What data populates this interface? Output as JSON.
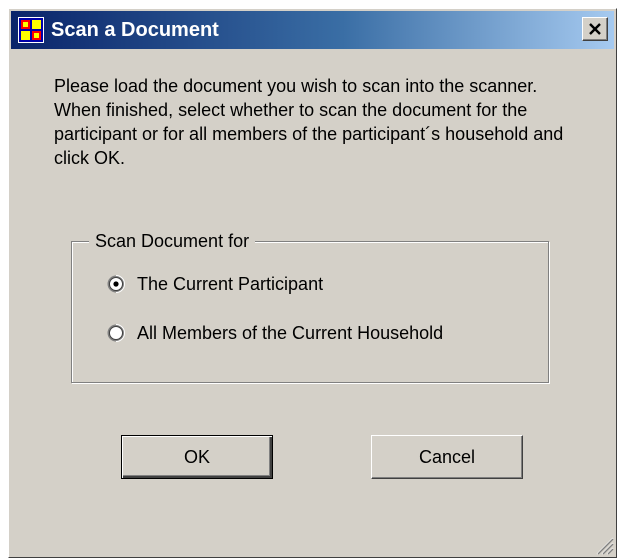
{
  "window": {
    "title": "Scan a Document",
    "app_icon": "form-app-icon",
    "close_icon": "close-x-icon"
  },
  "instructions": "Please load the document you wish to scan into the scanner.  When finished, select whether to scan the document for the participant or for all members of the participant´s household and click OK.",
  "scan_group": {
    "legend": "Scan Document for",
    "options": [
      {
        "label": "The Current Participant",
        "selected": true
      },
      {
        "label": "All Members of the Current Household",
        "selected": false
      }
    ]
  },
  "buttons": {
    "ok_label": "OK",
    "cancel_label": "Cancel"
  },
  "colors": {
    "face": "#d4d0c8",
    "title_start": "#0a246a",
    "title_end": "#a6caf0"
  }
}
